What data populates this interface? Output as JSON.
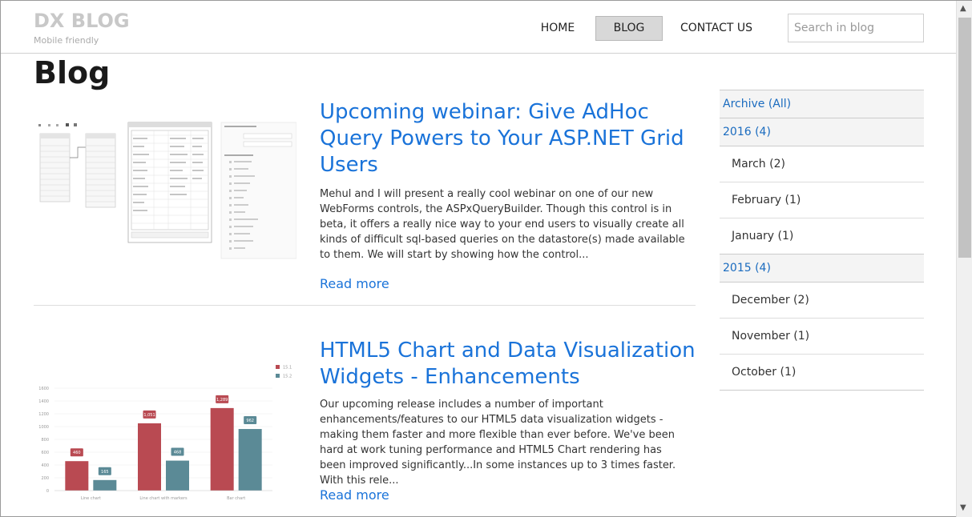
{
  "brand": {
    "title": "DX BLOG",
    "subtitle": "Mobile friendly"
  },
  "nav": {
    "items": [
      {
        "label": "HOME"
      },
      {
        "label": "BLOG",
        "active": true
      },
      {
        "label": "CONTACT US"
      }
    ]
  },
  "search": {
    "placeholder": "Search in blog",
    "value": ""
  },
  "page": {
    "title": "Blog"
  },
  "posts": [
    {
      "title": "Upcoming webinar: Give AdHoc Query Powers to Your ASP.NET Grid Users",
      "excerpt": "Mehul and I will present a really cool webinar on one of our new WebForms controls, the ASPxQueryBuilder. Though this control is in beta, it offers a really nice way to your end users to visually create all kinds of difficult sql-based queries on the datastore(s) made available to them. We will start by showing how the control...",
      "read_more": "Read more"
    },
    {
      "title": "HTML5 Chart and Data Visualization Widgets - Enhancements",
      "excerpt": "Our upcoming release includes a number of important enhancements/features to our HTML5 data visualization widgets - making them faster and more flexible than ever before. We've been hard at work tuning performance and HTML5 Chart rendering has been improved significantly...In some instances up to 3 times faster. With this rele...",
      "read_more": "Read more"
    }
  ],
  "archive": [
    {
      "label": "Archive (All)",
      "type": "header"
    },
    {
      "label": "2016 (4)",
      "type": "header"
    },
    {
      "label": "March (2)",
      "type": "month"
    },
    {
      "label": "February (1)",
      "type": "month"
    },
    {
      "label": "January (1)",
      "type": "month"
    },
    {
      "label": "2015 (4)",
      "type": "header"
    },
    {
      "label": "December (2)",
      "type": "month"
    },
    {
      "label": "November (1)",
      "type": "month"
    },
    {
      "label": "October (1)",
      "type": "month"
    }
  ],
  "thumb_chart": {
    "type": "bar",
    "categories": [
      "Line chart",
      "Line chart with markers",
      "Bar chart"
    ],
    "series": [
      {
        "name": "15.1",
        "values": [
          460,
          1051,
          1289
        ],
        "labels": [
          "460",
          "1,051",
          "1,289"
        ],
        "color": "#b94a52"
      },
      {
        "name": "15.2",
        "values": [
          165,
          468,
          962
        ],
        "labels": [
          "165",
          "468",
          "962"
        ],
        "color": "#5b8a96"
      }
    ],
    "yticks": [
      "0",
      "200",
      "400",
      "600",
      "800",
      "1000",
      "1200",
      "1400",
      "1600"
    ],
    "ylim": [
      0,
      1600
    ]
  },
  "colors": {
    "link": "#1a73d9",
    "brand": "#c8c8c8"
  }
}
